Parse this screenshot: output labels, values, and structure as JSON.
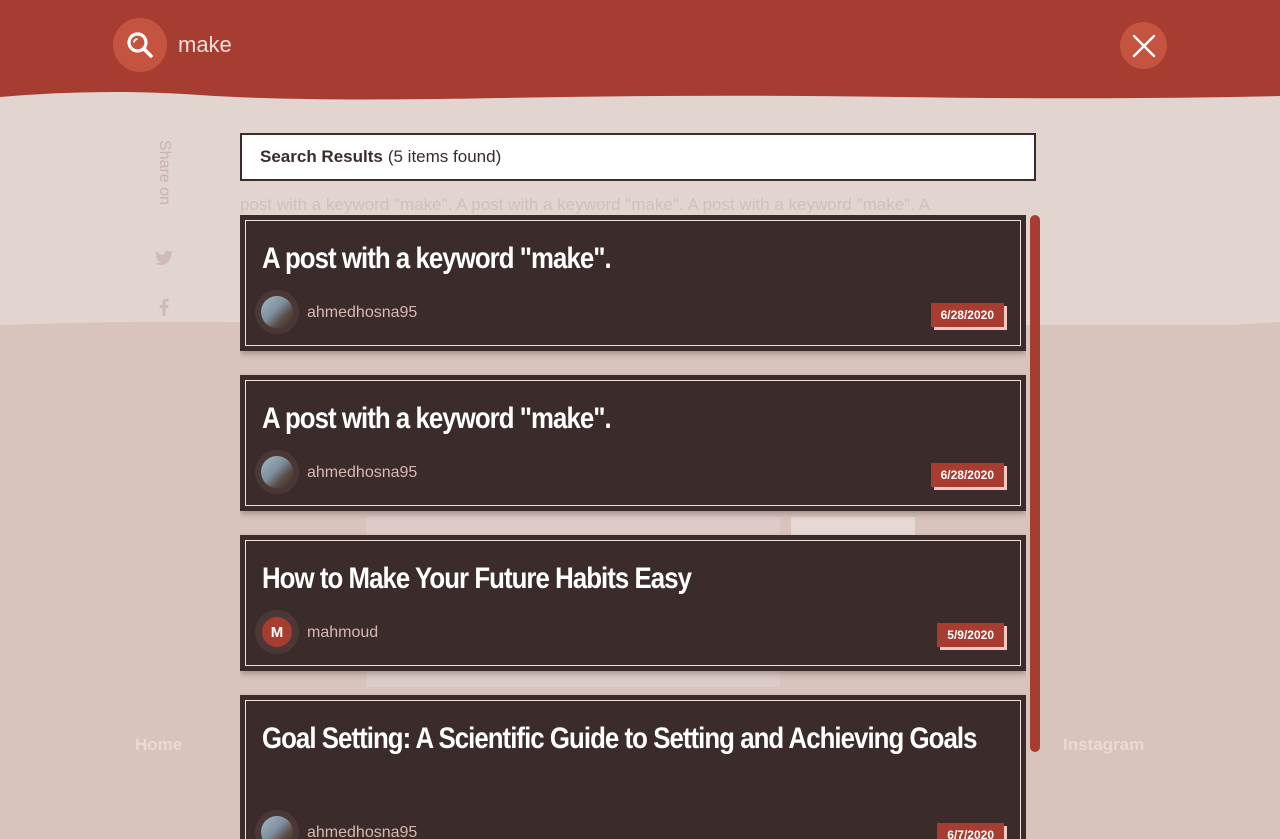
{
  "search": {
    "query": "make"
  },
  "results": {
    "heading": "Search Results",
    "count_text": "(5 items found)",
    "items": [
      {
        "title": "A post with a keyword \"make\".",
        "author": "ahmedhosna95",
        "avatar": "photo",
        "date": "6/28/2020"
      },
      {
        "title": "A post with a keyword \"make\".",
        "author": "ahmedhosna95",
        "avatar": "photo",
        "date": "6/28/2020"
      },
      {
        "title": "How to Make Your Future Habits Easy",
        "author": "mahmoud",
        "avatar": "M",
        "date": "5/9/2020"
      },
      {
        "title": "Goal Setting: A Scientific Guide to Setting and Achieving Goals",
        "author": "ahmedhosna95",
        "avatar": "photo",
        "date": "6/7/2020"
      }
    ]
  },
  "background": {
    "share_label": "Share on",
    "excerpt": "post with a keyword \"make\". A post with a keyword \"make\". A post with a keyword \"make\". A",
    "nav_left": "Home",
    "nav_right": "Instagram"
  },
  "colors": {
    "header": "#a73c30",
    "card": "#3b2c2b",
    "accent": "#a73c30"
  },
  "icons": {
    "search": "search-icon",
    "close": "close-icon"
  }
}
